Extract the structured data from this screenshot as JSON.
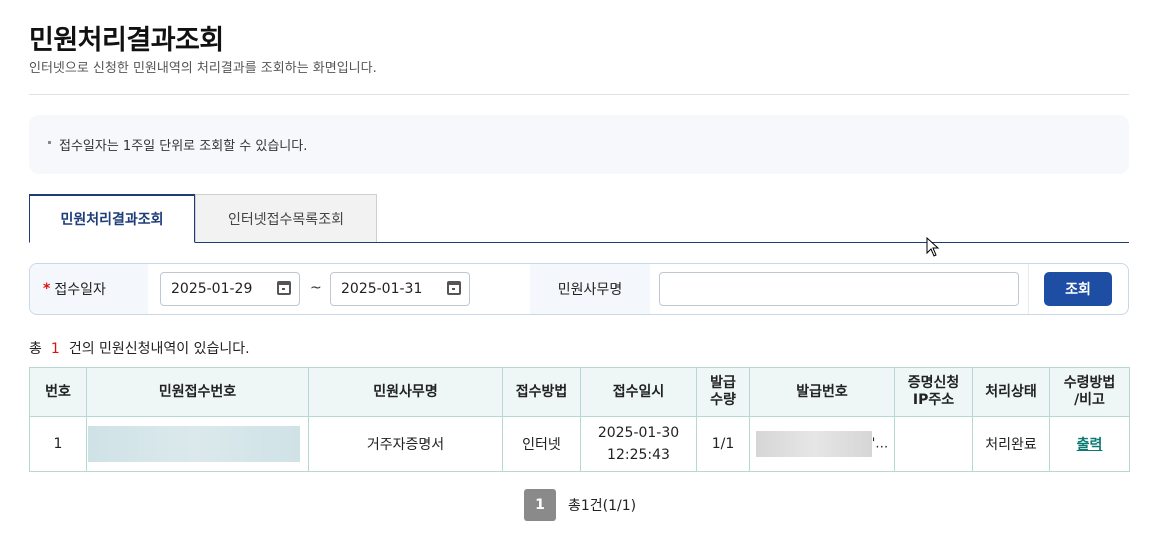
{
  "header": {
    "title": "민원처리결과조회",
    "description": "인터넷으로 신청한 민원내역의 처리결과를 조회하는 화면입니다."
  },
  "notice": {
    "text": "접수일자는 1주일 단위로 조회할 수 있습니다."
  },
  "tabs": [
    {
      "label": "민원처리결과조회",
      "active": true
    },
    {
      "label": "인터넷접수목록조회",
      "active": false
    }
  ],
  "search": {
    "required_mark": "*",
    "date_label": "접수일자",
    "date_from": "2025-01-29",
    "date_separator": "~",
    "date_to": "2025-01-31",
    "office_label": "민원사무명",
    "office_value": "",
    "submit_label": "조회"
  },
  "summary": {
    "prefix": "총",
    "count": "1",
    "suffix": "건의 민원신청내역이 있습니다."
  },
  "table": {
    "headers": {
      "no": "번호",
      "receipt_no": "민원접수번호",
      "office_name": "민원사무명",
      "method": "접수방법",
      "received_at": "접수일시",
      "issue_qty_1": "발급",
      "issue_qty_2": "수량",
      "issue_no": "발급번호",
      "ip_1": "증명신청",
      "ip_2": "IP주소",
      "status": "처리상태",
      "receive_1": "수령방법",
      "receive_2": "/비고"
    },
    "rows": [
      {
        "no": "1",
        "office_name": "거주자증명서",
        "method": "인터넷",
        "received_date": "2025-01-30",
        "received_time": "12:25:43",
        "issue_qty": "1/1",
        "issue_no_tail": "'…",
        "ip": "",
        "status": "처리완료",
        "action": "출력"
      }
    ]
  },
  "pagination": {
    "current": "1",
    "summary": "총1건(1/1)"
  },
  "colors": {
    "brand": "#1d3c78",
    "button": "#1d4ea3",
    "required": "#dd1111",
    "table_header_bg": "#eef7f6",
    "link": "#0b7a74"
  }
}
